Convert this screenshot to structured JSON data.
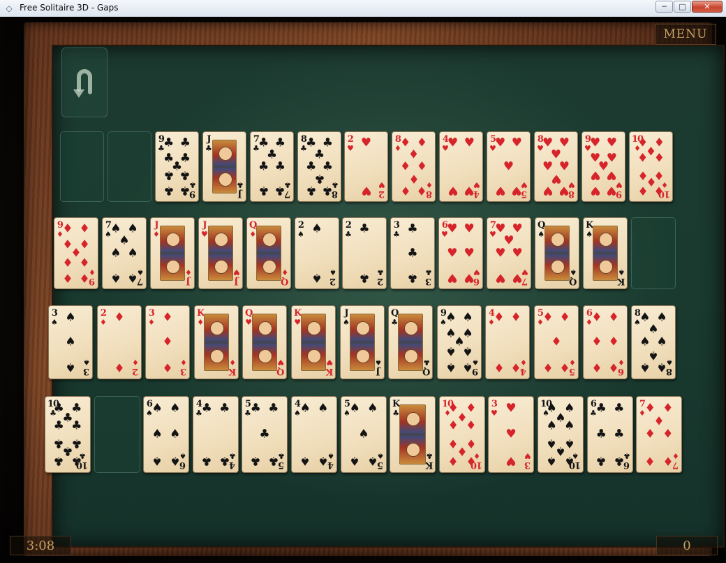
{
  "window": {
    "title": "Free Solitaire 3D - Gaps",
    "icon": "diamond-app-icon",
    "minimize_glyph": "─",
    "maximize_glyph": "□",
    "close_glyph": "✕"
  },
  "hud": {
    "menu_label": "MENU",
    "timer": "3:08",
    "score": "0",
    "undo_icon": "undo-icon"
  },
  "colors": {
    "felt": "#1a3a2f",
    "frame": "#6b3a1f",
    "hud_text": "#c5a063",
    "card_red": "#d6242b",
    "card_black": "#141414"
  },
  "rows": [
    [
      {
        "empty": true
      },
      {
        "empty": true
      },
      {
        "rank": "9",
        "suit": "♣"
      },
      {
        "rank": "J",
        "suit": "♣"
      },
      {
        "rank": "7",
        "suit": "♣"
      },
      {
        "rank": "8",
        "suit": "♣"
      },
      {
        "rank": "2",
        "suit": "♥"
      },
      {
        "rank": "8",
        "suit": "♦"
      },
      {
        "rank": "4",
        "suit": "♥"
      },
      {
        "rank": "5",
        "suit": "♥"
      },
      {
        "rank": "8",
        "suit": "♥"
      },
      {
        "rank": "9",
        "suit": "♥"
      },
      {
        "rank": "10",
        "suit": "♦"
      }
    ],
    [
      {
        "rank": "9",
        "suit": "♦"
      },
      {
        "rank": "7",
        "suit": "♠"
      },
      {
        "rank": "J",
        "suit": "♦"
      },
      {
        "rank": "J",
        "suit": "♥"
      },
      {
        "rank": "Q",
        "suit": "♦"
      },
      {
        "rank": "2",
        "suit": "♠"
      },
      {
        "rank": "2",
        "suit": "♣"
      },
      {
        "rank": "3",
        "suit": "♣"
      },
      {
        "rank": "6",
        "suit": "♥"
      },
      {
        "rank": "7",
        "suit": "♥"
      },
      {
        "rank": "Q",
        "suit": "♠"
      },
      {
        "rank": "K",
        "suit": "♠"
      },
      {
        "empty": true
      }
    ],
    [
      {
        "rank": "3",
        "suit": "♠"
      },
      {
        "rank": "2",
        "suit": "♦"
      },
      {
        "rank": "3",
        "suit": "♦"
      },
      {
        "rank": "K",
        "suit": "♦"
      },
      {
        "rank": "Q",
        "suit": "♥"
      },
      {
        "rank": "K",
        "suit": "♥"
      },
      {
        "rank": "J",
        "suit": "♠"
      },
      {
        "rank": "Q",
        "suit": "♣"
      },
      {
        "rank": "9",
        "suit": "♠"
      },
      {
        "rank": "4",
        "suit": "♦"
      },
      {
        "rank": "5",
        "suit": "♦"
      },
      {
        "rank": "6",
        "suit": "♦"
      },
      {
        "rank": "8",
        "suit": "♠"
      }
    ],
    [
      {
        "rank": "10",
        "suit": "♣"
      },
      {
        "empty": true
      },
      {
        "rank": "6",
        "suit": "♠"
      },
      {
        "rank": "4",
        "suit": "♣"
      },
      {
        "rank": "5",
        "suit": "♣"
      },
      {
        "rank": "4",
        "suit": "♠"
      },
      {
        "rank": "5",
        "suit": "♠"
      },
      {
        "rank": "K",
        "suit": "♣"
      },
      {
        "rank": "10",
        "suit": "♦"
      },
      {
        "rank": "3",
        "suit": "♥"
      },
      {
        "rank": "10",
        "suit": "♠"
      },
      {
        "rank": "6",
        "suit": "♣"
      },
      {
        "rank": "7",
        "suit": "♦"
      }
    ]
  ]
}
